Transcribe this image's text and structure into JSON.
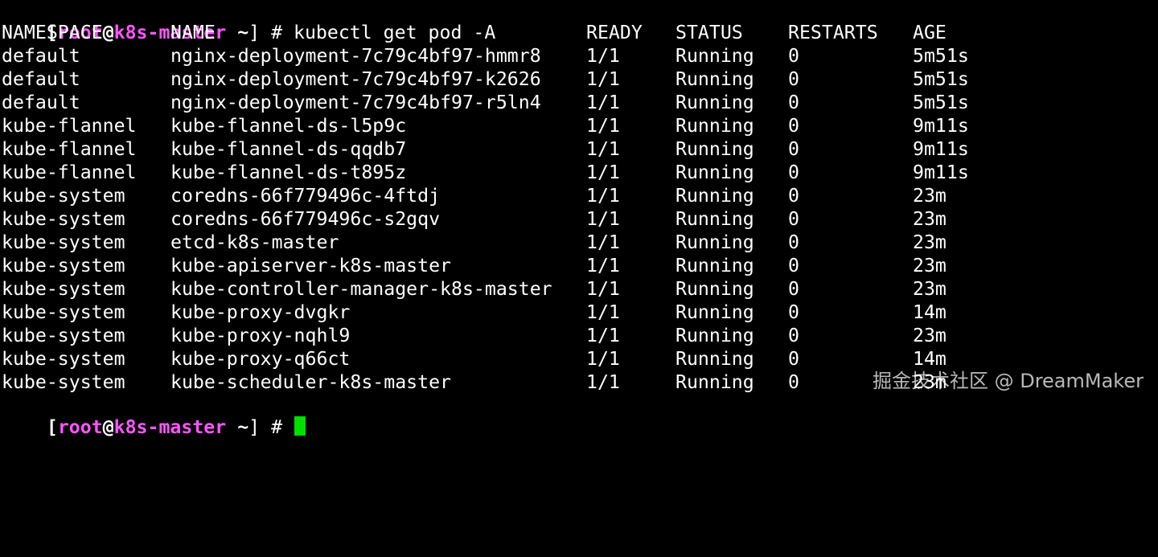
{
  "colors": {
    "background": "#000000",
    "text": "#ffffff",
    "prompt_accent": "#ff55ff",
    "cursor": "#00e000"
  },
  "prompt": {
    "open_bracket": "[",
    "user": "root",
    "at": "@",
    "host": "k8s-master",
    "dir": " ~",
    "close": "] # "
  },
  "command": "kubectl get pod -A",
  "table": {
    "headers": [
      "NAMESPACE",
      "NAME",
      "READY",
      "STATUS",
      "RESTARTS",
      "AGE"
    ],
    "rows": [
      [
        "default",
        "nginx-deployment-7c79c4bf97-hmmr8",
        "1/1",
        "Running",
        "0",
        "5m51s"
      ],
      [
        "default",
        "nginx-deployment-7c79c4bf97-k2626",
        "1/1",
        "Running",
        "0",
        "5m51s"
      ],
      [
        "default",
        "nginx-deployment-7c79c4bf97-r5ln4",
        "1/1",
        "Running",
        "0",
        "5m51s"
      ],
      [
        "kube-flannel",
        "kube-flannel-ds-l5p9c",
        "1/1",
        "Running",
        "0",
        "9m11s"
      ],
      [
        "kube-flannel",
        "kube-flannel-ds-qqdb7",
        "1/1",
        "Running",
        "0",
        "9m11s"
      ],
      [
        "kube-flannel",
        "kube-flannel-ds-t895z",
        "1/1",
        "Running",
        "0",
        "9m11s"
      ],
      [
        "kube-system",
        "coredns-66f779496c-4ftdj",
        "1/1",
        "Running",
        "0",
        "23m"
      ],
      [
        "kube-system",
        "coredns-66f779496c-s2gqv",
        "1/1",
        "Running",
        "0",
        "23m"
      ],
      [
        "kube-system",
        "etcd-k8s-master",
        "1/1",
        "Running",
        "0",
        "23m"
      ],
      [
        "kube-system",
        "kube-apiserver-k8s-master",
        "1/1",
        "Running",
        "0",
        "23m"
      ],
      [
        "kube-system",
        "kube-controller-manager-k8s-master",
        "1/1",
        "Running",
        "0",
        "23m"
      ],
      [
        "kube-system",
        "kube-proxy-dvgkr",
        "1/1",
        "Running",
        "0",
        "14m"
      ],
      [
        "kube-system",
        "kube-proxy-nqhl9",
        "1/1",
        "Running",
        "0",
        "23m"
      ],
      [
        "kube-system",
        "kube-proxy-q66ct",
        "1/1",
        "Running",
        "0",
        "14m"
      ],
      [
        "kube-system",
        "kube-scheduler-k8s-master",
        "1/1",
        "Running",
        "0",
        "23m"
      ]
    ]
  },
  "watermark": "掘金技术社区 @ DreamMaker"
}
